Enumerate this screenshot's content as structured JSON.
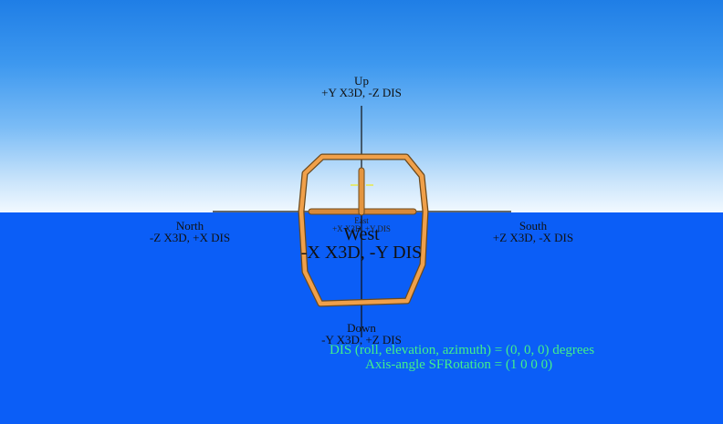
{
  "labels": {
    "up": {
      "name": "Up",
      "coords": "+Y X3D, -Z DIS"
    },
    "north": {
      "name": "North",
      "coords": "-Z X3D, +X DIS"
    },
    "south": {
      "name": "South",
      "coords": "+Z X3D, -X DIS"
    },
    "down": {
      "name": "Down",
      "coords": "-Y X3D, +Z DIS"
    },
    "west": {
      "name": "West",
      "coords": "-X X3D, -Y DIS"
    },
    "east": {
      "name": "East",
      "coords": "+X X3D, +Y DIS"
    }
  },
  "hud": {
    "orientation": "DIS (roll, elevation, azimuth) = (0, 0, 0) degrees",
    "rotation": "Axis-angle SFRotation = (1 0 0 0)"
  },
  "colors": {
    "sky_top": "#1f7ee6",
    "sky_horizon": "#f2f9ff",
    "ground": "#0b5ef7",
    "axis_lines": "#111111",
    "model": "#f0a04a",
    "hud_text": "#43f08a"
  },
  "icons": {
    "model": "orientation-frame-model-icon",
    "axis": "axis-crosshair-icon"
  }
}
